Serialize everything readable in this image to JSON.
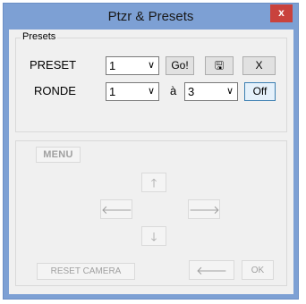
{
  "window": {
    "title": "Ptzr & Presets",
    "close_glyph": "x"
  },
  "presets": {
    "legend": "Presets",
    "preset_label": "PRESET",
    "preset_value": "1",
    "go_label": "Go!",
    "save_glyph": "🖫",
    "clear_label": "X",
    "ronde_label": "RONDE",
    "ronde_from": "1",
    "a_label": "à",
    "ronde_to": "3",
    "off_label": "Off",
    "dropdown_glyph": "∨"
  },
  "camera": {
    "menu_label": "MENU",
    "up_glyph": "🡑",
    "left_glyph": "🡐",
    "right_glyph": "🡒",
    "down_glyph": "🡓",
    "reset_label": "RESET CAMERA",
    "back_glyph": "🡐",
    "ok_label": "OK"
  }
}
